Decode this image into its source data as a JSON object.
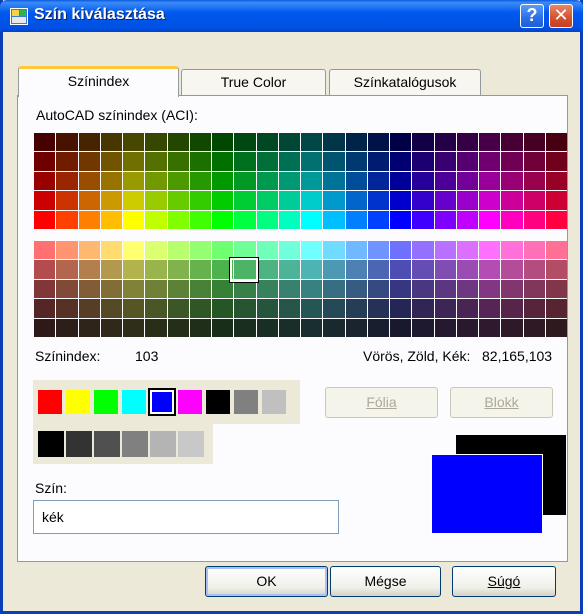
{
  "window": {
    "title": "Szín kiválasztása"
  },
  "tabs": [
    {
      "label": "Színindex",
      "active": true
    },
    {
      "label": "True Color",
      "active": false
    },
    {
      "label": "Színkatalógusok",
      "active": false
    }
  ],
  "aci": {
    "heading": "AutoCAD színindex (ACI):"
  },
  "info": {
    "index_label": "Színindex:",
    "index_value": "103",
    "rgb_label": "Vörös, Zöld, Kék:",
    "rgb_value": "82,165,103"
  },
  "standard_colors": [
    "#ff0000",
    "#ffff00",
    "#00ff00",
    "#00ffff",
    "#0000ff",
    "#ff00ff",
    "#000000",
    "#808080",
    "#c0c0c0"
  ],
  "gray_shades": [
    "#000000",
    "#333333",
    "#505050",
    "#808080",
    "#b4b4b4",
    "#c8c8c8"
  ],
  "buttons": {
    "folia": "Fólia",
    "blokk": "Blokk",
    "ok": "OK",
    "megse": "Mégse",
    "sugo": "Súgó"
  },
  "color_field": {
    "label": "Szín:",
    "value": "kék"
  },
  "preview": {
    "new_color": "#0000ff",
    "old_color": "#000000"
  },
  "colors": {
    "title_bar": "#0058ee",
    "dialog_bg": "#ece9d8",
    "active_tab_accent": "#ffc83c"
  }
}
